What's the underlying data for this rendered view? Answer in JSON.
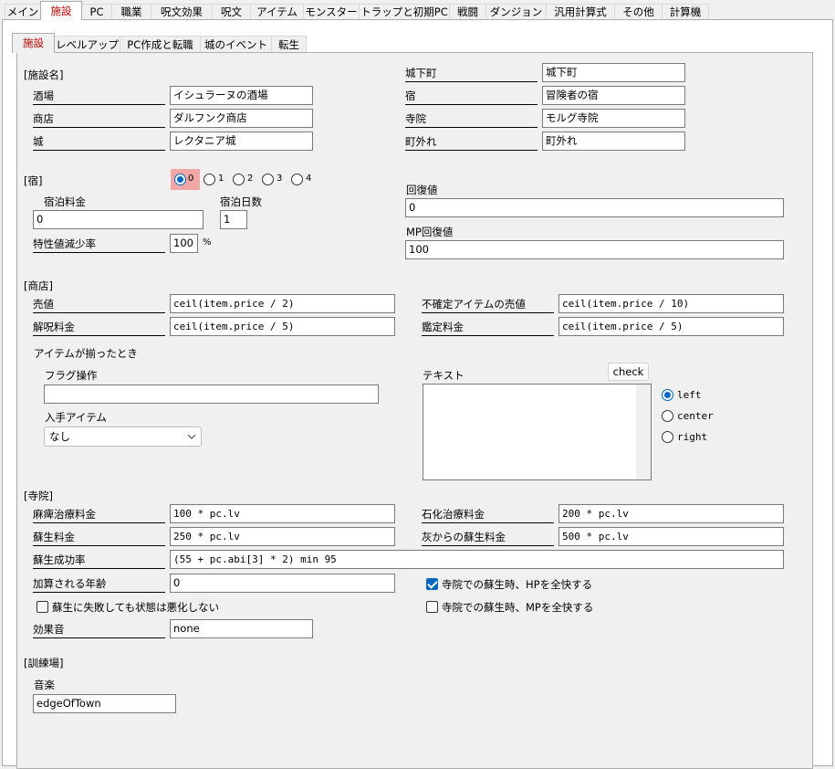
{
  "main_tabs": [
    "メイン",
    "施設",
    "PC",
    "職業",
    "呪文効果",
    "呪文",
    "アイテム",
    "モンスター",
    "トラップと初期PC",
    "戦闘",
    "ダンジョン",
    "汎用計算式",
    "その他",
    "計算機"
  ],
  "sub_tabs": [
    "施設",
    "レベルアップ",
    "PC作成と転職",
    "城のイベント",
    "転生"
  ],
  "names": {
    "section": "[施設名]",
    "tavern_label": "酒場",
    "tavern_value": "イシュラーヌの酒場",
    "shop_label": "商店",
    "shop_value": "ダルフンク商店",
    "castle_label": "城",
    "castle_value": "レクタニア城",
    "town_label": "城下町",
    "town_value": "城下町",
    "inn_label": "宿",
    "inn_value": "冒険者の宿",
    "temple_label": "寺院",
    "temple_value": "モルグ寺院",
    "outskirts_label": "町外れ",
    "outskirts_value": "町外れ"
  },
  "inn": {
    "section": "[宿]",
    "radios": [
      "0",
      "1",
      "2",
      "3",
      "4"
    ],
    "selected": "0",
    "fee_label": "宿泊料金",
    "fee_value": "0",
    "days_label": "宿泊日数",
    "days_value": "1",
    "stat_label": "特性値減少率",
    "stat_value": "100",
    "stat_unit": "%",
    "recovery_label": "回復値",
    "recovery_value": "0",
    "mp_label": "MP回復値",
    "mp_value": "100"
  },
  "shop": {
    "section": "[商店]",
    "sell_label": "売値",
    "sell_value": "ceil(item.price / 2)",
    "uncurse_label": "解呪料金",
    "uncurse_value": "ceil(item.price / 5)",
    "unk_sell_label": "不確定アイテムの売値",
    "unk_sell_value": "ceil(item.price / 10)",
    "appraise_label": "鑑定料金",
    "appraise_value": "ceil(item.price / 5)",
    "complete_label": "アイテムが揃ったとき",
    "flag_label": "フラグ操作",
    "flag_value": "",
    "get_item_label": "入手アイテム",
    "get_item_value": "なし",
    "text_label": "テキスト",
    "check_label": "check",
    "align_options": [
      "left",
      "center",
      "right"
    ],
    "align_selected": "left"
  },
  "temple": {
    "section": "[寺院]",
    "paralysis_label": "麻痺治療料金",
    "paralysis_value": "100 * pc.lv",
    "revive_label": "蘇生料金",
    "revive_value": "250 * pc.lv",
    "stone_label": "石化治療料金",
    "stone_value": "200 * pc.lv",
    "ash_label": "灰からの蘇生料金",
    "ash_value": "500 * pc.lv",
    "success_label": "蘇生成功率",
    "success_value": "(55 + pc.abi[3] * 2) min 95",
    "age_label": "加算される年齢",
    "age_value": "0",
    "hp_full_label": "寺院での蘇生時、HPを全快する",
    "hp_full_checked": true,
    "mp_full_label": "寺院での蘇生時、MPを全快する",
    "mp_full_checked": false,
    "no_worse_label": "蘇生に失敗しても状態は悪化しない",
    "no_worse_checked": false,
    "sound_label": "効果音",
    "sound_value": "none"
  },
  "training": {
    "section": "[訓練場]",
    "music_label": "音楽",
    "music_value": "edgeOfTown"
  },
  "colors": {
    "accent": "#0067c0",
    "tab_selected_text": "#c00000",
    "radio_highlight": "#f4a6a6"
  }
}
